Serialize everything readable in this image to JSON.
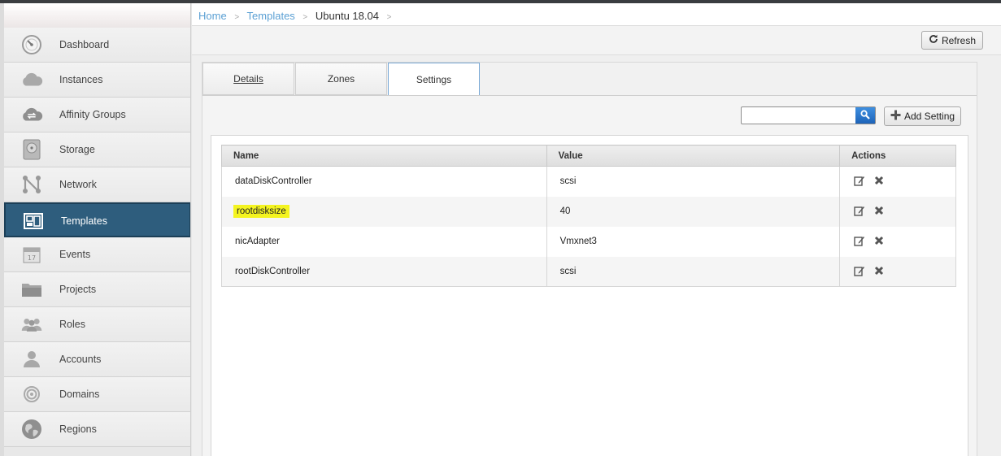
{
  "breadcrumb": {
    "home": "Home",
    "templates": "Templates",
    "current": "Ubuntu 18.04"
  },
  "toolbar": {
    "refresh_label": "Refresh"
  },
  "sidebar": {
    "items": [
      {
        "label": "Dashboard",
        "icon": "dashboard-icon"
      },
      {
        "label": "Instances",
        "icon": "cloud-icon"
      },
      {
        "label": "Affinity Groups",
        "icon": "affinity-cloud-icon"
      },
      {
        "label": "Storage",
        "icon": "disk-icon"
      },
      {
        "label": "Network",
        "icon": "network-icon"
      },
      {
        "label": "Templates",
        "icon": "templates-icon",
        "active": true
      },
      {
        "label": "Events",
        "icon": "calendar-icon"
      },
      {
        "label": "Projects",
        "icon": "folder-icon"
      },
      {
        "label": "Roles",
        "icon": "roles-icon"
      },
      {
        "label": "Accounts",
        "icon": "user-icon"
      },
      {
        "label": "Domains",
        "icon": "domains-icon"
      },
      {
        "label": "Regions",
        "icon": "globe-icon"
      }
    ]
  },
  "tabs": [
    {
      "label": "Details"
    },
    {
      "label": "Zones"
    },
    {
      "label": "Settings",
      "active": true
    }
  ],
  "settings": {
    "search_placeholder": "",
    "add_label": "Add Setting",
    "columns": [
      "Name",
      "Value",
      "Actions"
    ],
    "rows": [
      {
        "name": "dataDiskController",
        "value": "scsi"
      },
      {
        "name": "rootdisksize",
        "value": "40",
        "highlighted": true
      },
      {
        "name": "nicAdapter",
        "value": "Vmxnet3"
      },
      {
        "name": "rootDiskController",
        "value": "scsi"
      }
    ]
  },
  "colors": {
    "active_nav": "#2e5d7d",
    "link": "#5ba0d4",
    "highlight": "#f4f420",
    "search_button": "#1d63b8"
  }
}
